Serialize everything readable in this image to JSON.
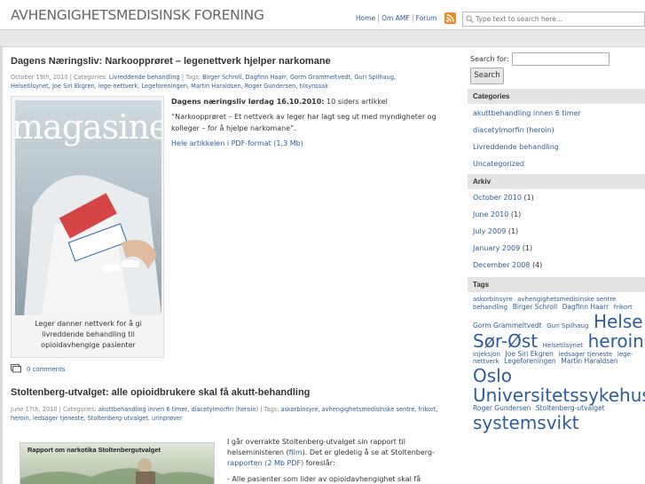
{
  "header": {
    "site_title": "AVHENGIGHETSMEDISINSK FORENING",
    "nav": [
      "Home",
      "Om AMF",
      "Forum"
    ],
    "search_placeholder": "Type text to search here..."
  },
  "posts": [
    {
      "title": "Dagens Næringsliv: Narkoopprøret – legenettverk hjelper narkomane",
      "meta_date": "October 19th, 2010 | Categories:",
      "meta_categories": "Livreddende behandling",
      "meta_tags_label": "| Tags:",
      "meta_tags": "Birger Schroll, Dagfinn Haarr, Gorm Grammeltvedt, Guri Spilhaug, Helsetilsynet, Joe Siri Ekgren, lege-nettverk, Legeforeningen, Martin Haraldsen, Roger Gundersen, tilsynssak",
      "image_alt": "magasinet",
      "caption": "Leger danner nettverk for å gi livreddende behandling til opioidavhengige pasienter",
      "p1_bold": "Dagens næringsliv lørdag 16.10.2010:",
      "p1_rest": " 10 siders artikkel",
      "p2": "“Narkoopprøret – Et nettverk av leger har lagt seg ut med myndigheter og kolleger – for å hjelpe narkomane”.",
      "p3_link": "Hele artikkelen i PDF-format (1,3 Mb)",
      "comments": "0 comments"
    },
    {
      "title": "Stoltenberg-utvalget: alle opioidbrukere skal få akutt-behandling",
      "meta_date": "June 17th, 2010 | Categories:",
      "meta_categories": "akuttbehandling innen 6 timer, diacetylmorfin (heroin)",
      "meta_tags_label": "| Tags:",
      "meta_tags": "askorbinsyre, avhengighetsmedisinske sentre, frikort, heroin, ledsager tjeneste, Stoltenberg-utvalget, urinprøver",
      "image_text": "Rapport om narkotika Stoltenbergutvalget",
      "p1_a": "I går overrakte  Stoltenberg-utvalget sin rapport til helseministeren (",
      "p1_link": "film",
      "p1_b": ").  Det er gledelig å se at Stoltenberg-",
      "p1_link2": "rapporten (2 Mb PDF)",
      "p1_c": " foreslår:",
      "p2": "- Alle pasienter som lider av opioidavhengighet skal få"
    }
  ],
  "sidebar": {
    "search_label": "Search for:",
    "search_button": "Search",
    "categories_title": "Categories",
    "categories": [
      "akuttbehandling innen 6 timer",
      "diacetylmorfin (heroin)",
      "Livreddende behandling",
      "Uncategorized"
    ],
    "archive_title": "Arkiv",
    "archive": [
      {
        "month": "October 2010",
        "count": "(1)"
      },
      {
        "month": "June 2010",
        "count": "(1)"
      },
      {
        "month": "July 2009",
        "count": "(1)"
      },
      {
        "month": "January 2009",
        "count": "(1)"
      },
      {
        "month": "December 2008",
        "count": "(4)"
      }
    ],
    "tags_title": "Tags",
    "tags": [
      {
        "t": "askorbinsyre",
        "s": 7
      },
      {
        "t": "avhengighetsmedisinske sentre",
        "s": 7
      },
      {
        "t": "behandling",
        "s": 7
      },
      {
        "t": "Birger Schroll",
        "s": 7.5
      },
      {
        "t": "Dagfinn Haarr",
        "s": 7.5
      },
      {
        "t": "frikort",
        "s": 7
      },
      {
        "t": "Gorm Grammeltvedt",
        "s": 7.5
      },
      {
        "t": "Guri Spilhaug",
        "s": 7
      },
      {
        "t": "Helse",
        "s": 20
      },
      {
        "t": "Sør-Øst",
        "s": 20
      },
      {
        "t": "Helsetilsynet",
        "s": 7
      },
      {
        "t": "heroin",
        "s": 20
      },
      {
        "t": "injeksjon",
        "s": 7
      },
      {
        "t": "Joe Siri Ekgren",
        "s": 7.5
      },
      {
        "t": "ledsager tjeneste",
        "s": 7
      },
      {
        "t": "lege-nettverk",
        "s": 7
      },
      {
        "t": "Legeforeningen",
        "s": 7.5
      },
      {
        "t": "Martin Haraldsen",
        "s": 7.5
      },
      {
        "t": "Oslo",
        "s": 20
      },
      {
        "t": "Universitetssykehus",
        "s": 20
      },
      {
        "t": "Roger Gundersen",
        "s": 7.5
      },
      {
        "t": "Stoltenberg-utvalget",
        "s": 7.5
      },
      {
        "t": "systemsvikt",
        "s": 20
      }
    ]
  }
}
